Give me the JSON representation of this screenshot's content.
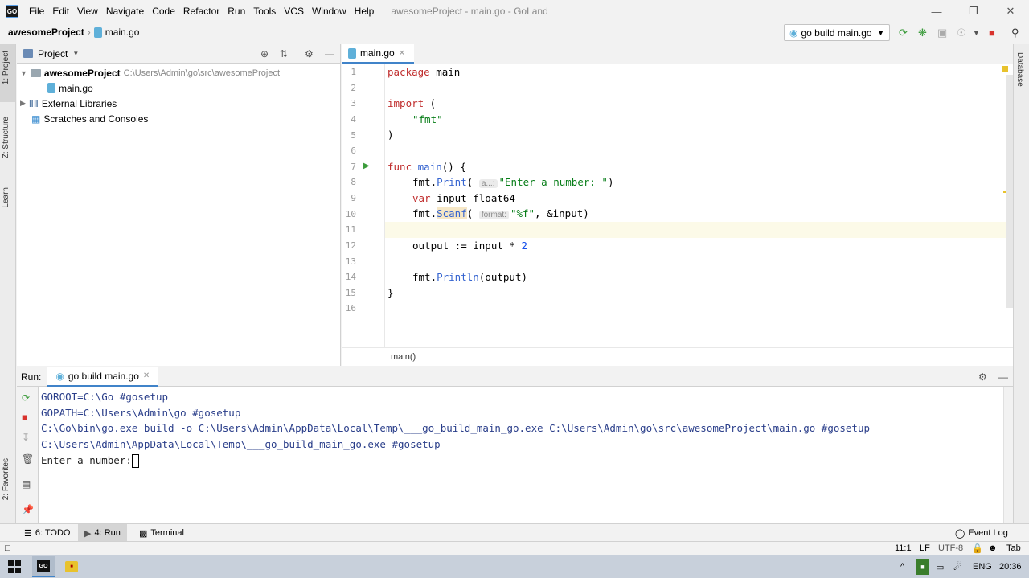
{
  "titlebar": {
    "menu": [
      "File",
      "Edit",
      "View",
      "Navigate",
      "Code",
      "Refactor",
      "Run",
      "Tools",
      "VCS",
      "Window",
      "Help"
    ],
    "title": "awesomeProject - main.go - GoLand",
    "logo": "GO"
  },
  "navbar": {
    "project": "awesomeProject",
    "file": "main.go",
    "run_config": "go build main.go"
  },
  "left_strip": {
    "project": "1: Project",
    "structure": "Z: Structure",
    "learn": "Learn",
    "favorites": "2: Favorites"
  },
  "right_strip": {
    "database": "Database"
  },
  "project_panel": {
    "title": "Project",
    "tree": {
      "root": "awesomeProject",
      "root_path": "C:\\Users\\Admin\\go\\src\\awesomeProject",
      "file": "main.go",
      "libs": "External Libraries",
      "scratches": "Scratches and Consoles"
    }
  },
  "editor": {
    "tab": "main.go",
    "line_numbers": [
      "1",
      "2",
      "3",
      "4",
      "5",
      "6",
      "7",
      "8",
      "9",
      "10",
      "11",
      "12",
      "13",
      "14",
      "15",
      "16"
    ],
    "code": {
      "l1_kw": "package",
      "l1_rest": " main",
      "l3_kw": "import",
      "l3_rest": " (",
      "l4": "\"fmt\"",
      "l5": ")",
      "l7_kw": "func",
      "l7_fn": "main",
      "l7_rest": "() {",
      "l8_pre": "fmt.",
      "l8_fn": "Print",
      "l8_hint": "a...:",
      "l8_str": "\"Enter a number: \"",
      "l8_end": ")",
      "l9_kw": "var",
      "l9_rest": " input float64",
      "l10_pre": "fmt.",
      "l10_fn": "Scanf",
      "l10_hint": "format:",
      "l10_str": "\"%f\"",
      "l10_end": ", &input)",
      "l12_pre": "output := input * ",
      "l12_num": "2",
      "l14_pre": "fmt.",
      "l14_fn": "Println",
      "l14_end": "(output)",
      "l15": "}"
    },
    "breadcrumb": "main()"
  },
  "run_panel": {
    "label": "Run:",
    "tab": "go build main.go",
    "lines": [
      "GOROOT=C:\\Go #gosetup",
      "GOPATH=C:\\Users\\Admin\\go #gosetup",
      "C:\\Go\\bin\\go.exe build -o C:\\Users\\Admin\\AppData\\Local\\Temp\\___go_build_main_go.exe C:\\Users\\Admin\\go\\src\\awesomeProject\\main.go #gosetup",
      "C:\\Users\\Admin\\AppData\\Local\\Temp\\___go_build_main_go.exe #gosetup"
    ],
    "prompt": "Enter a number:"
  },
  "bottom_tabs": {
    "todo": "6: TODO",
    "run": "4: Run",
    "terminal": "Terminal",
    "event_log": "Event Log"
  },
  "statusbar": {
    "position": "11:1",
    "line_sep": "LF",
    "encoding": "UTF-8",
    "indent": "Tab"
  },
  "taskbar": {
    "lang": "ENG",
    "time": "20:36"
  }
}
